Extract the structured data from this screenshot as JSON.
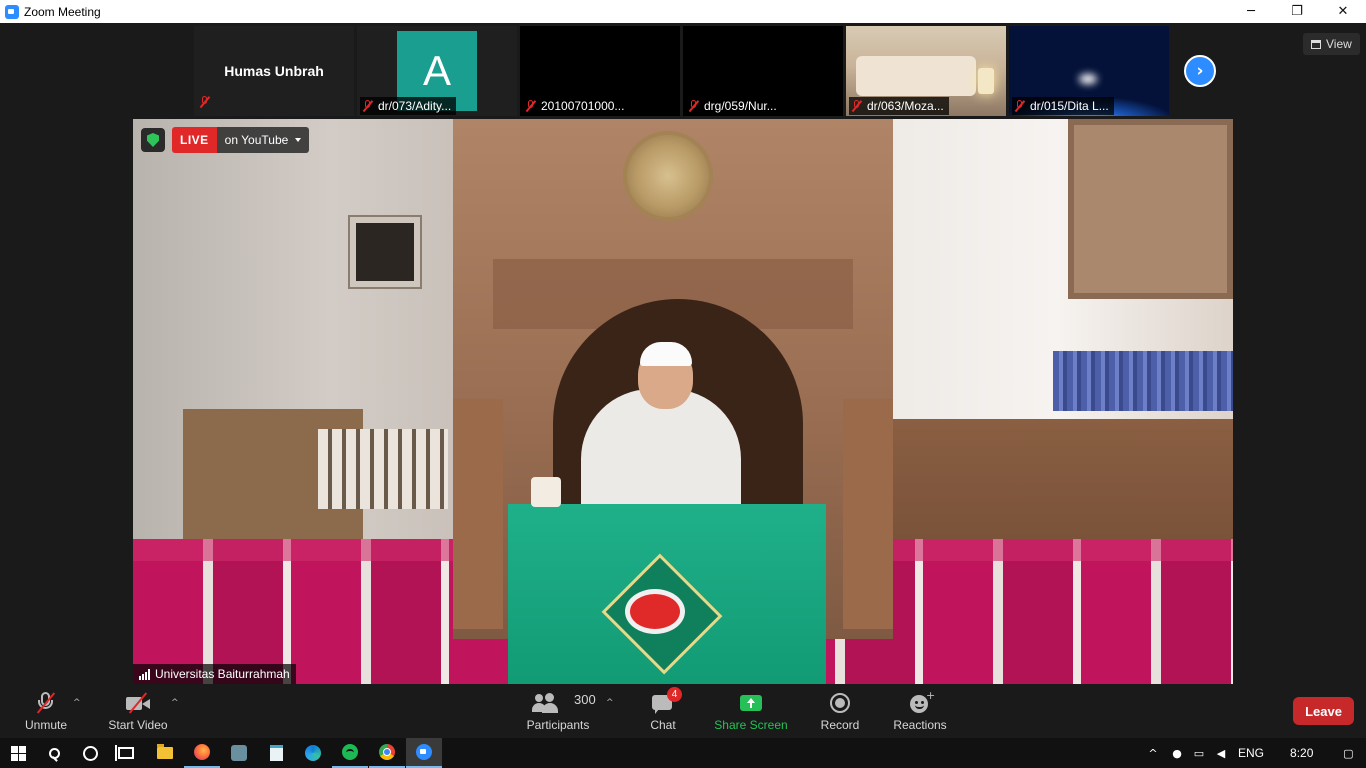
{
  "window": {
    "title": "Zoom Meeting",
    "controls": {
      "minimize": "─",
      "restore": "❐",
      "close": "✕"
    }
  },
  "thumbnails": [
    {
      "name": "Humas Unbrah",
      "label": "",
      "type": "name-only"
    },
    {
      "name": "dr/073/Adity...",
      "label": "dr/073/Adity...",
      "type": "avatar",
      "avatar_letter": "A",
      "avatar_color": "#1a9e8f"
    },
    {
      "name": "20100701000...",
      "label": "20100701000...",
      "type": "video-off"
    },
    {
      "name": "drg/059/Nur...",
      "label": "drg/059/Nur...",
      "type": "video-off"
    },
    {
      "name": "dr/063/Moza...",
      "label": "dr/063/Moza...",
      "type": "video-room"
    },
    {
      "name": "dr/015/Dita L...",
      "label": "dr/015/Dita L...",
      "type": "video-space"
    }
  ],
  "view_button": {
    "label": "View"
  },
  "main_video": {
    "live_badge": "LIVE",
    "live_destination": "on YouTube",
    "speaker_name": "Universitas Baiturrahmah"
  },
  "toolbar": {
    "unmute": "Unmute",
    "start_video": "Start Video",
    "participants": "Participants",
    "participants_count": "300",
    "chat": "Chat",
    "chat_badge": "4",
    "share_screen": "Share Screen",
    "record": "Record",
    "reactions": "Reactions",
    "leave": "Leave"
  },
  "colors": {
    "accent_blue": "#2d8cff",
    "share_green": "#27c058",
    "leave_red": "#c7292b",
    "live_red": "#e02828",
    "mute_red": "#e02828"
  },
  "taskbar": {
    "apps": [
      "start-menu",
      "search",
      "cortana",
      "task-view",
      "file-explorer",
      "firefox",
      "generic-app",
      "notepad",
      "edge",
      "spotify",
      "chrome",
      "zoom"
    ],
    "language": "ENG",
    "time": "8:20"
  }
}
